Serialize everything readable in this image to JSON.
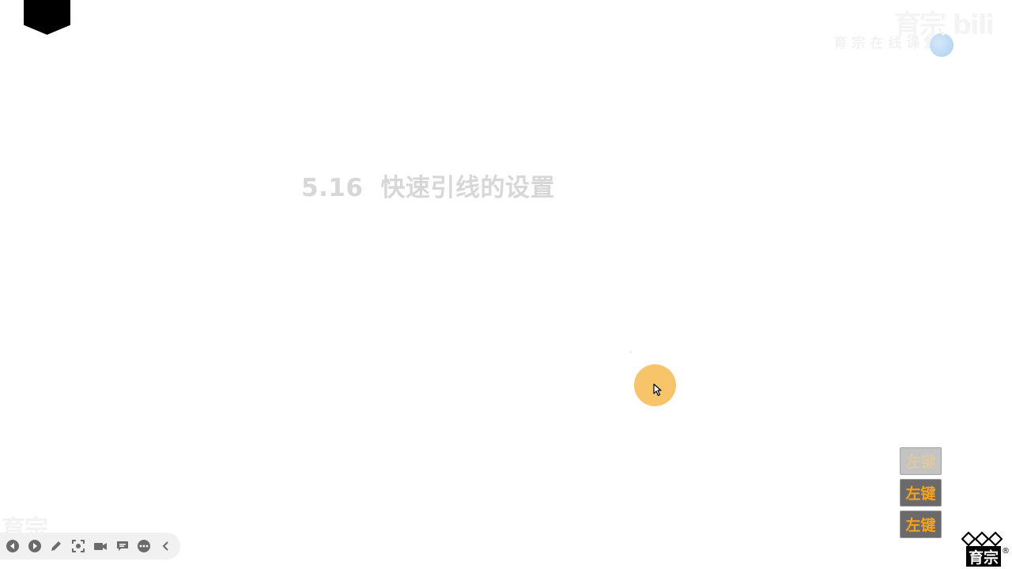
{
  "slide": {
    "title_number": "5.16",
    "title_text": "快速引线的设置"
  },
  "watermark": {
    "top_text": "育 宗 在 线 课 堂",
    "top_brand": "育宗 bili",
    "bottom_left": "育宗"
  },
  "key_badges": [
    {
      "label": "左键"
    },
    {
      "label": "左键"
    },
    {
      "label": "左键"
    }
  ],
  "toolbar": {
    "items": [
      {
        "name": "prev-icon"
      },
      {
        "name": "next-icon"
      },
      {
        "name": "pen-icon"
      },
      {
        "name": "screenshot-icon"
      },
      {
        "name": "camera-icon"
      },
      {
        "name": "comment-icon"
      },
      {
        "name": "more-icon"
      },
      {
        "name": "collapse-icon"
      }
    ]
  },
  "logo": {
    "text": "育宗",
    "reg": "®"
  },
  "colors": {
    "cursor_highlight": "#f8c46a",
    "key_text": "#f5a020",
    "title": "#d7d7d7"
  }
}
